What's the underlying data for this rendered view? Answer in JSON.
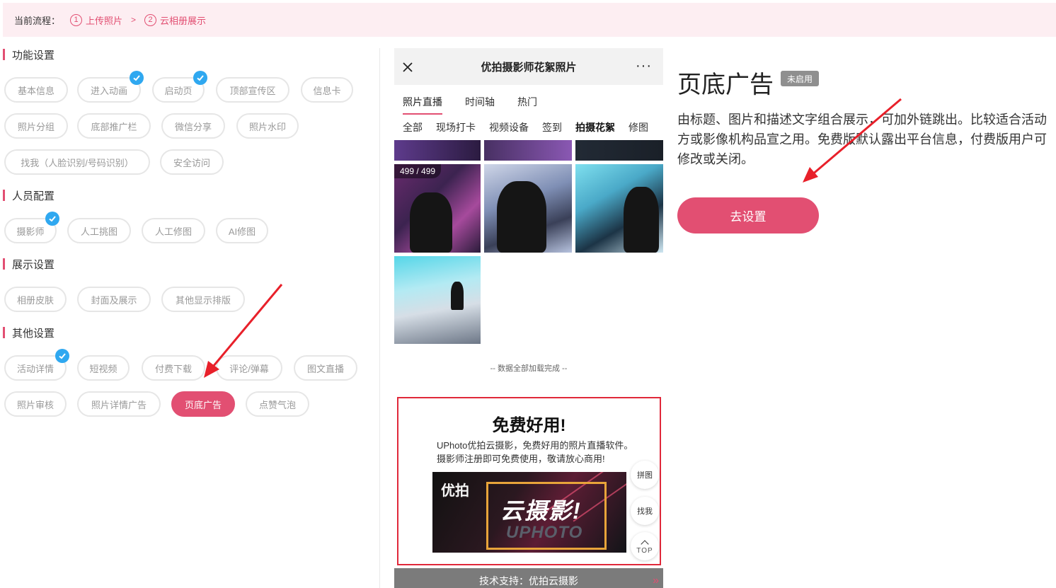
{
  "process": {
    "label": "当前流程：",
    "steps": [
      {
        "num": "1",
        "label": "上传照片"
      },
      {
        "num": "2",
        "label": "云相册展示"
      }
    ],
    "separator": ">"
  },
  "sections": {
    "function": {
      "title": "功能设置",
      "items": [
        "基本信息",
        "进入动画",
        "启动页",
        "顶部宣传区",
        "信息卡",
        "照片分组",
        "底部推广栏",
        "微信分享",
        "照片水印",
        "找我（人脸识别/号码识别）",
        "安全访问"
      ]
    },
    "staff": {
      "title": "人员配置",
      "items": [
        "摄影师",
        "人工挑图",
        "人工修图",
        "AI修图"
      ]
    },
    "display": {
      "title": "展示设置",
      "items": [
        "相册皮肤",
        "封面及展示",
        "其他显示排版"
      ]
    },
    "other": {
      "title": "其他设置",
      "items": [
        "活动详情",
        "短视频",
        "付费下载",
        "评论/弹幕",
        "图文直播",
        "照片审核",
        "照片详情广告",
        "页底广告",
        "点赞气泡"
      ]
    }
  },
  "phone": {
    "title": "优拍摄影师花絮照片",
    "more": "···",
    "tabs": [
      "照片直播",
      "时间轴",
      "热门"
    ],
    "subtabs": [
      "全部",
      "现场打卡",
      "视频设备",
      "签到",
      "拍摄花絮",
      "修图"
    ],
    "counter": "499 / 499",
    "loaded": "-- 数据全部加载完成 --",
    "ad": {
      "title": "免费好用!",
      "line1": "UPhoto优拍云摄影，免费好用的照片直播软件。",
      "line2": "摄影师注册即可免费使用，敬请放心商用!",
      "banner_logo": "优拍",
      "banner_big": "云摄影!",
      "banner_en": "UPHOTO"
    },
    "float_buttons": {
      "collage": "拼图",
      "find": "找我",
      "top": "TOP"
    },
    "footer": "技术支持：优拍云摄影",
    "footer_arrows": "»"
  },
  "detail": {
    "title": "页底广告",
    "badge": "未启用",
    "description": "由标题、图片和描述文字组合展示，可加外链跳出。比较适合活动方或影像机构品宣之用。免费版默认露出平台信息，付费版用户可修改或关闭。",
    "button": "去设置"
  },
  "colors": {
    "accent": "#e24f72",
    "check": "#2fa8f0",
    "arrow": "#e8202a",
    "process_bg": "#fdeef2"
  }
}
